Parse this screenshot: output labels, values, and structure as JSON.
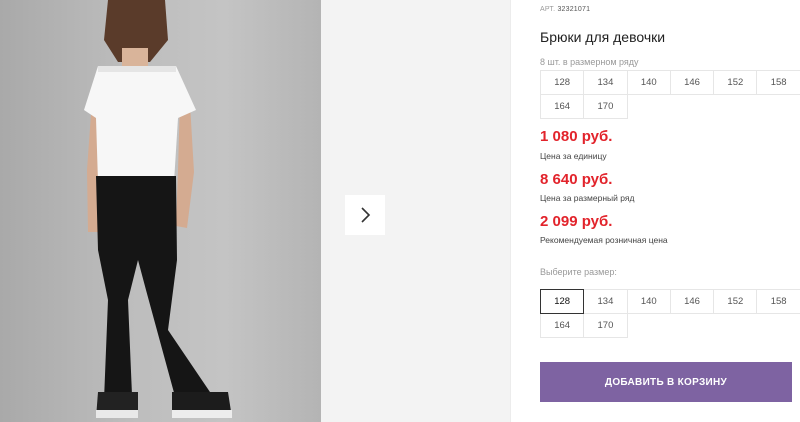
{
  "product": {
    "article_label": "АРТ.",
    "article_number": "32321071",
    "title": "Брюки для девочки"
  },
  "series": {
    "label": "8 шт. в размерном ряду",
    "sizes": [
      "128",
      "134",
      "140",
      "146",
      "152",
      "158",
      "164",
      "170"
    ]
  },
  "prices": [
    {
      "value": "1 080 руб.",
      "note": "Цена за единицу"
    },
    {
      "value": "8 640 руб.",
      "note": "Цена за размерный ряд"
    },
    {
      "value": "2 099 руб.",
      "note": "Рекомендуемая розничная цена"
    }
  ],
  "size_select": {
    "label": "Выберите размер:",
    "selected": "128",
    "sizes": [
      "128",
      "134",
      "140",
      "146",
      "152",
      "158",
      "164",
      "170"
    ]
  },
  "cart_button": {
    "label": "ДОБАВИТЬ В КОРЗИНУ"
  },
  "colors": {
    "price": "#e2232b",
    "button": "#7e63a2"
  },
  "icons": {
    "next": "chevron-right-icon"
  }
}
